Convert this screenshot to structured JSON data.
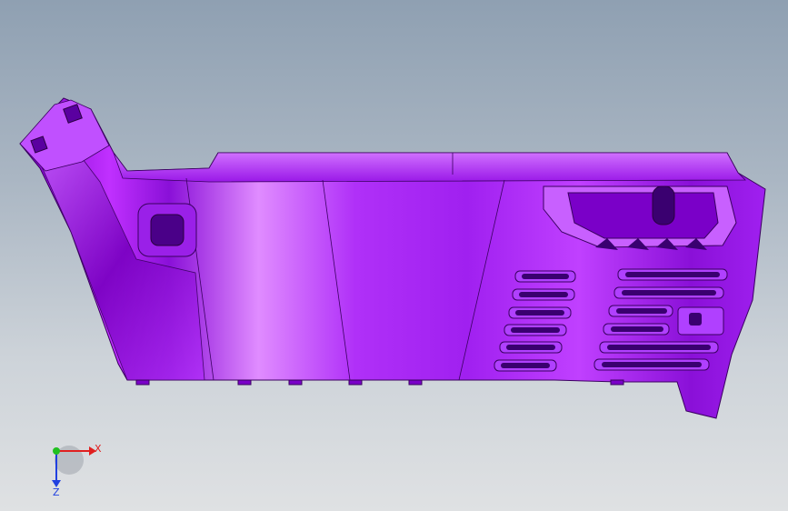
{
  "viewport": {
    "background_top": "#8fa0b2",
    "background_bottom": "#dfe1e3"
  },
  "model": {
    "color": "#b41cff",
    "shade_color": "#7a00c8",
    "highlight_color": "#e6a0ff"
  },
  "triad": {
    "x_label": "X",
    "z_label": "Z",
    "x_color": "#e02020",
    "y_color": "#20c020",
    "z_color": "#2040e0"
  }
}
